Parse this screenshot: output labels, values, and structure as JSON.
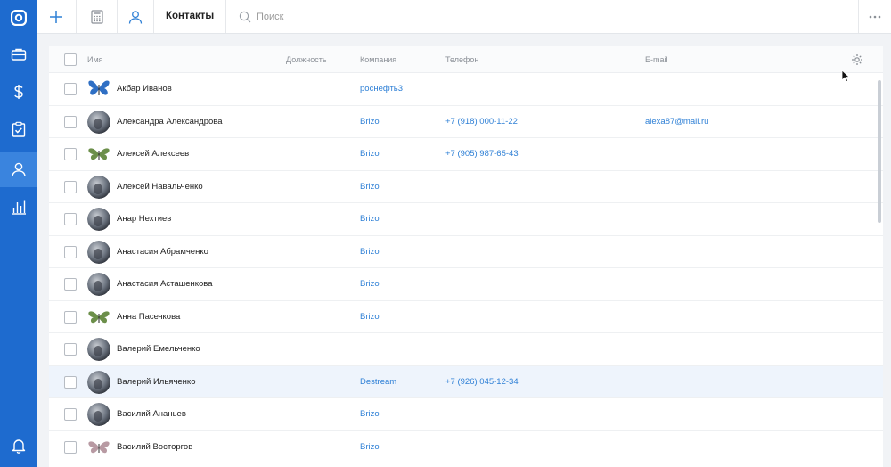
{
  "sidebar": {
    "items": [
      {
        "icon": "logo-icon",
        "active": false
      },
      {
        "icon": "briefcase-icon",
        "active": false
      },
      {
        "icon": "dollar-icon",
        "active": false
      },
      {
        "icon": "clipboard-check-icon",
        "active": false
      },
      {
        "icon": "contacts-icon",
        "active": true
      },
      {
        "icon": "bar-chart-icon",
        "active": false
      },
      {
        "icon": "bell-icon",
        "active": false
      }
    ]
  },
  "toolbar": {
    "title": "Контакты",
    "search_placeholder": "Поиск"
  },
  "table": {
    "columns": {
      "name": "Имя",
      "position": "Должность",
      "company": "Компания",
      "phone": "Телефон",
      "email": "E-mail"
    },
    "rows": [
      {
        "name": "Акбар Иванов",
        "company": "роснефть3",
        "phone": "",
        "email": "",
        "avatar": "butterfly-blue",
        "highlighted": false
      },
      {
        "name": "Александра Александрова",
        "company": "Brizo",
        "phone": "+7 (918) 000-11-22",
        "email": "alexa87@mail.ru",
        "avatar": "photo",
        "highlighted": false
      },
      {
        "name": "Алексей Алексеев",
        "company": "Brizo",
        "phone": "+7 (905) 987-65-43",
        "email": "",
        "avatar": "butterfly-green",
        "highlighted": false
      },
      {
        "name": "Алексей Навальченко",
        "company": "Brizo",
        "phone": "",
        "email": "",
        "avatar": "photo",
        "highlighted": false
      },
      {
        "name": "Анар Нехтиев",
        "company": "Brizo",
        "phone": "",
        "email": "",
        "avatar": "photo",
        "highlighted": false
      },
      {
        "name": "Анастасия Абрамченко",
        "company": "Brizo",
        "phone": "",
        "email": "",
        "avatar": "photo",
        "highlighted": false
      },
      {
        "name": "Анастасия Асташенкова",
        "company": "Brizo",
        "phone": "",
        "email": "",
        "avatar": "photo",
        "highlighted": false
      },
      {
        "name": "Анна Пасечкова",
        "company": "Brizo",
        "phone": "",
        "email": "",
        "avatar": "butterfly-green",
        "highlighted": false
      },
      {
        "name": "Валерий Емельченко",
        "company": "",
        "phone": "",
        "email": "",
        "avatar": "photo",
        "highlighted": false
      },
      {
        "name": "Валерий Ильяченко",
        "company": "Destream",
        "phone": "+7 (926) 045-12-34",
        "email": "",
        "avatar": "photo",
        "highlighted": true
      },
      {
        "name": "Василий Ананьев",
        "company": "Brizo",
        "phone": "",
        "email": "",
        "avatar": "photo",
        "highlighted": false
      },
      {
        "name": "Василий Восторгов",
        "company": "Brizo",
        "phone": "",
        "email": "",
        "avatar": "butterfly-pink",
        "highlighted": false
      }
    ]
  },
  "colors": {
    "sidebar": "#1e6bcf",
    "sidebar_active": "#3a84de",
    "link": "#2f80d6",
    "row_highlight": "#eef4fc"
  }
}
